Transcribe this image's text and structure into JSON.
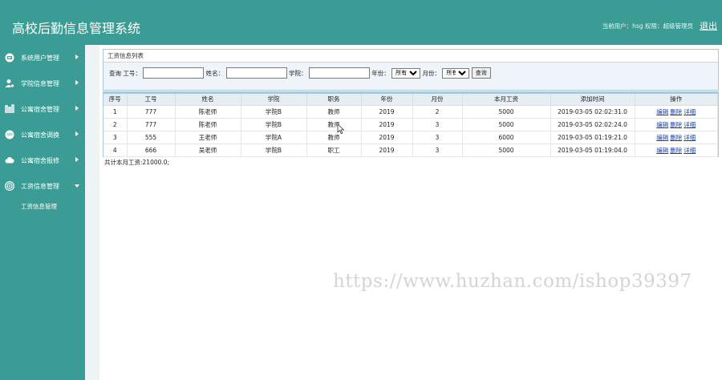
{
  "header": {
    "title": "高校后勤信息管理系统",
    "user_info": "当前用户：hsg 权限：超级管理员",
    "logout": "退出"
  },
  "sidebar": {
    "items": [
      {
        "label": "系统用户管理",
        "icon": "user-badge-icon"
      },
      {
        "label": "学院信息管理",
        "icon": "person-gear-icon"
      },
      {
        "label": "公寓宿舍管理",
        "icon": "building-icon"
      },
      {
        "label": "公寓宿舍调换",
        "icon": "app-icon"
      },
      {
        "label": "公寓宿舍报修",
        "icon": "cloud-icon"
      },
      {
        "label": "工资信息管理",
        "icon": "target-icon"
      }
    ],
    "submenu": "工资信息管理"
  },
  "panel": {
    "title": "工资信息列表"
  },
  "search": {
    "query_label": "查询",
    "id_label": "工号：",
    "name_label": "姓名：",
    "college_label": "学院：",
    "year_label": "年份：",
    "year_value": "所有",
    "month_label": "月份：",
    "month_value": "所有",
    "button": "查询"
  },
  "table": {
    "headers": [
      "序号",
      "工号",
      "姓名",
      "学院",
      "职务",
      "年份",
      "月份",
      "本月工资",
      "添加时间",
      "操作"
    ],
    "rows": [
      {
        "no": "1",
        "id": "777",
        "name": "陈老师",
        "college": "学院B",
        "position": "教师",
        "year": "2019",
        "month": "2",
        "salary": "5000",
        "time": "2019-03-05 02:02:31.0"
      },
      {
        "no": "2",
        "id": "777",
        "name": "陈老师",
        "college": "学院B",
        "position": "教师",
        "year": "2019",
        "month": "3",
        "salary": "5000",
        "time": "2019-03-05 02:02:24.0"
      },
      {
        "no": "3",
        "id": "555",
        "name": "王老师",
        "college": "学院A",
        "position": "教师",
        "year": "2019",
        "month": "3",
        "salary": "6000",
        "time": "2019-03-05 01:19:21.0"
      },
      {
        "no": "4",
        "id": "666",
        "name": "吴老师",
        "college": "学院B",
        "position": "职工",
        "year": "2019",
        "month": "3",
        "salary": "5000",
        "time": "2019-03-05 01:19:04.0"
      }
    ],
    "actions": [
      "编辑",
      "删除",
      "详细"
    ]
  },
  "total": "共计本月工资:21000.0;",
  "watermark": "https://www.huzhan.com/ishop39397",
  "colors": {
    "brand": "#3a9c94",
    "link": "#1a3fb0",
    "panel_border": "#a9c8db"
  }
}
